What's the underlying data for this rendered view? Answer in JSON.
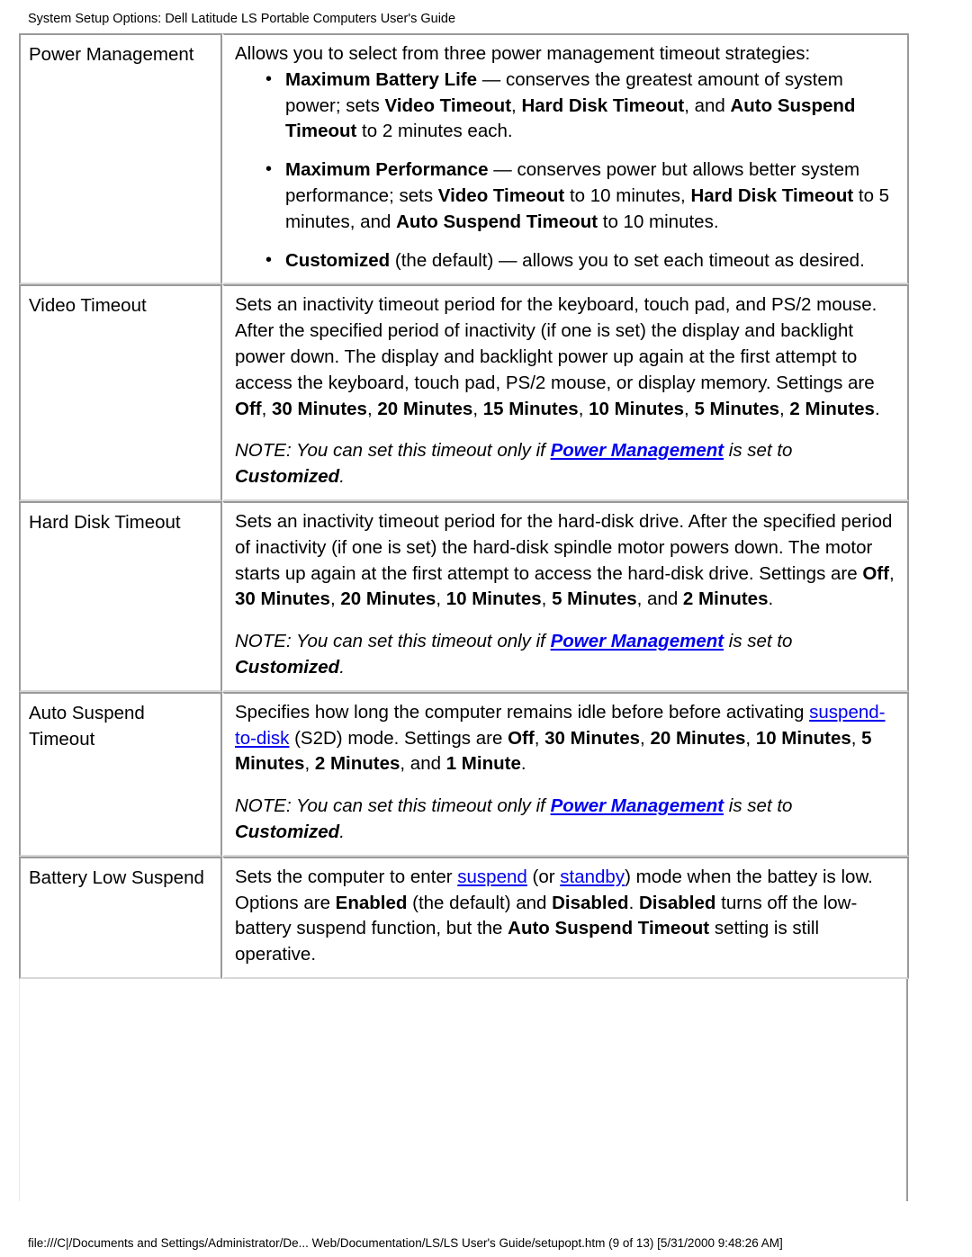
{
  "page": {
    "header_title": "System Setup Options: Dell Latitude LS Portable Computers User's Guide",
    "footer": "file:///C|/Documents and Settings/Administrator/De... Web/Documentation/LS/LS User's Guide/setupopt.htm (9 of 13) [5/31/2000 9:48:26 AM]",
    "link_color": "#0000ee",
    "text_color": "#000000",
    "background_color": "#ffffff",
    "border_color": "#9a9a9a"
  },
  "table": {
    "rows": [
      {
        "name": "Power Management",
        "lead": "Allows you to select from three power management timeout strategies:",
        "bullets": [
          {
            "term": "Maximum Battery Life",
            "dash": " — ",
            "body_1": "conserves the greatest amount of system power; sets ",
            "b_1": "Video Timeout",
            "body_2": ", ",
            "b_2": "Hard Disk Timeout",
            "body_3": ", and ",
            "b_3": "Auto Suspend Timeout",
            "body_4": " to 2 minutes each."
          },
          {
            "term": "Maximum Performance",
            "dash": " — ",
            "body_1": "conserves power but allows better system performance; sets ",
            "b_1": "Video Timeout",
            "body_2": " to 10 minutes, ",
            "b_2": "Hard Disk Timeout",
            "body_3": " to 5 minutes, and ",
            "b_3": "Auto Suspend Timeout",
            "body_4": " to 10 minutes."
          },
          {
            "term": "Customized",
            "dash": " ",
            "body_1": "(the default) — allows you to set each timeout as desired.",
            "b_1": "",
            "body_2": "",
            "b_2": "",
            "body_3": "",
            "b_3": "",
            "body_4": ""
          }
        ]
      },
      {
        "name": "Video Timeout",
        "body_1": "Sets an inactivity timeout period for the keyboard, touch pad, and PS/2 mouse. After the specified period of inactivity (if one is set) the display and backlight power down. The display and backlight power up again at the first attempt to access the keyboard, touch pad, PS/2 mouse, or display memory. Settings are ",
        "settings": [
          "Off",
          "30 Minutes",
          "20 Minutes",
          "15 Minutes",
          "10 Minutes",
          "5 Minutes",
          "2 Minutes"
        ],
        "note_prefix": "NOTE: You can set this timeout only if ",
        "note_link": "Power Management",
        "note_middle": " is set to ",
        "note_bold": "Customized",
        "note_suffix": "."
      },
      {
        "name": "Hard Disk Timeout",
        "body_1": "Sets an inactivity timeout period for the hard-disk drive. After the specified period of inactivity (if one is set) the hard-disk spindle motor powers down. The motor starts up again at the first attempt to access the hard-disk drive. Settings are ",
        "settings": [
          "Off",
          "30 Minutes",
          "20 Minutes",
          "10 Minutes",
          "5 Minutes",
          "2 Minutes"
        ],
        "settings_conjunction": "and",
        "note_prefix": "NOTE: You can set this timeout only if ",
        "note_link": "Power Management",
        "note_middle": " is set to ",
        "note_bold": "Customized",
        "note_suffix": "."
      },
      {
        "name": "Auto Suspend Timeout",
        "body_1": "Specifies how long the computer remains idle before before activating ",
        "link": "suspend-to-disk",
        "body_2": " (S2D) mode. Settings are ",
        "settings": [
          "Off",
          "30 Minutes",
          "20 Minutes",
          "10 Minutes",
          "5 Minutes",
          "2 Minutes",
          "1 Minute"
        ],
        "settings_conjunction": "and",
        "note_prefix": "NOTE: You can set this timeout only if ",
        "note_link": "Power Management",
        "note_middle": " is set to ",
        "note_bold": "Customized",
        "note_suffix": "."
      },
      {
        "name": "Battery Low Suspend",
        "body_1": "Sets the computer to enter ",
        "link_1": "suspend",
        "body_2": " (or ",
        "link_2": "standby",
        "body_3": ") mode when the battey is low. Options are ",
        "b_1": "Enabled",
        "body_4": " (the default) and ",
        "b_2": "Disabled",
        "body_5": ". ",
        "b_3": "Disabled",
        "body_6": " turns off the low-battery suspend function, but the ",
        "b_4": "Auto Suspend Timeout",
        "body_7": " setting is still operative."
      }
    ]
  }
}
